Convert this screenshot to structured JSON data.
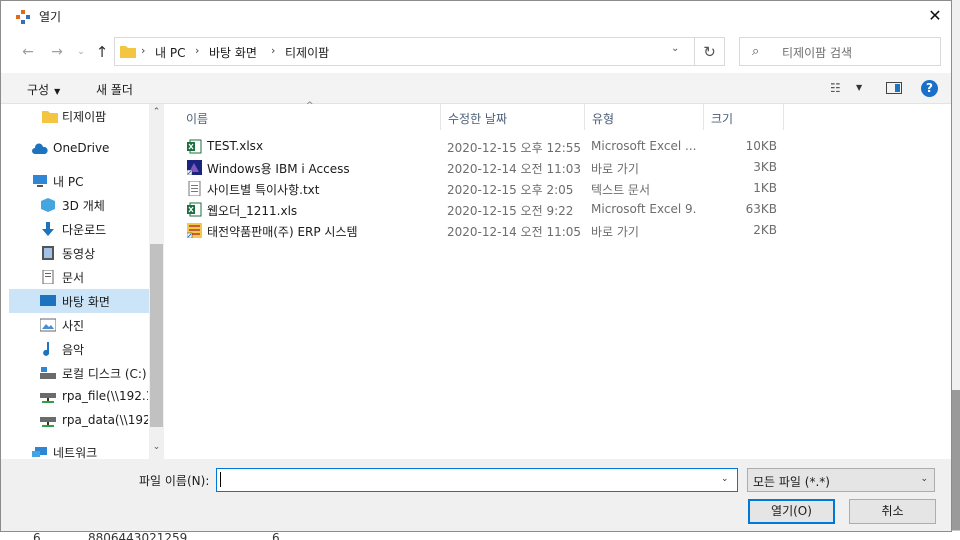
{
  "window": {
    "title": "열기",
    "close_glyph": "✕"
  },
  "nav": {
    "back": "←",
    "forward": "→",
    "history": "⌄",
    "up": "↑"
  },
  "address": {
    "crumbs": [
      "내 PC",
      "바탕 화면",
      "티제이팜"
    ],
    "separator": "›",
    "dropdown": "⌄",
    "refresh": "↻"
  },
  "search": {
    "icon": "⌕",
    "placeholder": "티제이팜 검색"
  },
  "toolbar": {
    "organize_label": "구성",
    "organize_caret": "▼",
    "new_folder_label": "새 폴더",
    "view_icon": "☷",
    "view_caret": "▼",
    "help_label": "?"
  },
  "sidebar": {
    "scroll_up": "⌃",
    "scroll_down": "⌄",
    "items": [
      {
        "label": "티제이팜",
        "icon": "folder-icon"
      },
      {
        "label": "OneDrive",
        "icon": "cloud-icon"
      },
      {
        "label": "내 PC",
        "icon": "computer-icon"
      },
      {
        "label": "3D 개체",
        "icon": "cube-icon"
      },
      {
        "label": "다운로드",
        "icon": "download-icon"
      },
      {
        "label": "동영상",
        "icon": "video-icon"
      },
      {
        "label": "문서",
        "icon": "document-icon"
      },
      {
        "label": "바탕 화면",
        "icon": "desktop-icon",
        "selected": true
      },
      {
        "label": "사진",
        "icon": "picture-icon"
      },
      {
        "label": "음악",
        "icon": "music-icon"
      },
      {
        "label": "로컬 디스크 (C:)",
        "icon": "drive-icon"
      },
      {
        "label": "rpa_file(\\\\192.1",
        "icon": "network-drive-icon"
      },
      {
        "label": "rpa_data(\\\\192",
        "icon": "network-drive-icon"
      },
      {
        "label": "네트워크",
        "icon": "network-icon"
      }
    ]
  },
  "filelist": {
    "sort_glyph": "^",
    "columns": {
      "name": "이름",
      "date": "수정한 날짜",
      "type": "유형",
      "size": "크기"
    },
    "files": [
      {
        "name": "TEST.xlsx",
        "date": "2020-12-15 오후 12:55",
        "type": "Microsoft Excel ...",
        "size": "10KB",
        "icon": "excel-icon"
      },
      {
        "name": "Windows용 IBM i Access",
        "date": "2020-12-14 오전 11:03",
        "type": "바로 가기",
        "size": "3KB",
        "icon": "shortcut-icon"
      },
      {
        "name": "사이트별 특이사항.txt",
        "date": "2020-12-15 오후 2:05",
        "type": "텍스트 문서",
        "size": "1KB",
        "icon": "text-file-icon"
      },
      {
        "name": "웹오더_1211.xls",
        "date": "2020-12-15 오전 9:22",
        "type": "Microsoft Excel 9...",
        "size": "63KB",
        "icon": "excel-icon"
      },
      {
        "name": "태전약품판매(주) ERP 시스템",
        "date": "2020-12-14 오전 11:05",
        "type": "바로 가기",
        "size": "2KB",
        "icon": "erp-shortcut-icon"
      }
    ]
  },
  "bottom": {
    "filename_label": "파일 이름(N):",
    "filename_value": "",
    "filename_caret": "⌄",
    "filetype_value": "모든 파일 (*.*)",
    "filetype_caret": "⌄",
    "open_label": "열기(O)",
    "cancel_label": "취소"
  },
  "background": {
    "cell_a": "6",
    "cell_b": "8806443021259",
    "cell_c": "6"
  },
  "colors": {
    "accent": "#0078d7",
    "selected": "#cce4f7",
    "folder": "#f4c542",
    "excel": "#1d6f42"
  }
}
